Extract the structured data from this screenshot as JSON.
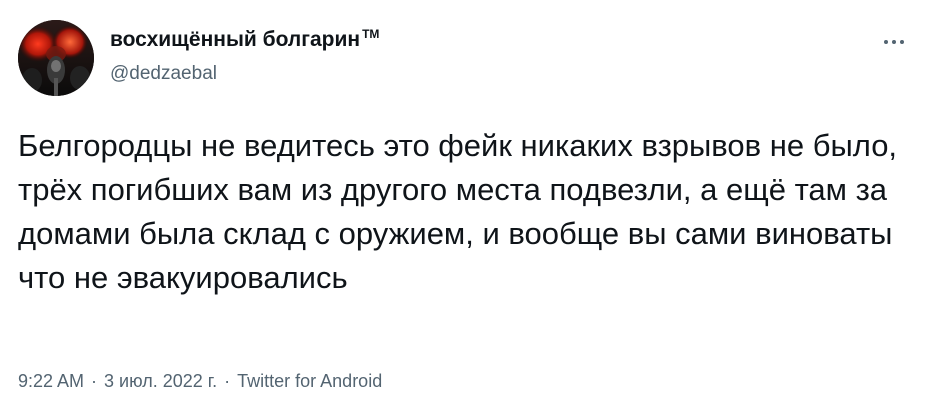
{
  "author": {
    "display_name": "восхищённый болгарин",
    "badge": "TM",
    "handle": "@dedzaebal",
    "avatar_icon": "profile-avatar"
  },
  "menu": {
    "icon": "more-options-icon"
  },
  "tweet": {
    "text": "Белгородцы не ведитесь это фейк никаких взрывов не было, трёх погибших вам из другого места подвезли, а ещё там за домами была склад с оружием, и вообще вы сами виноваты что не эвакуировались"
  },
  "meta": {
    "time": "9:22 AM",
    "separator": "·",
    "date": "3 июл. 2022 г.",
    "source": "Twitter for Android"
  },
  "colors": {
    "text_primary": "#0f1419",
    "text_secondary": "#536471",
    "background": "#ffffff"
  }
}
